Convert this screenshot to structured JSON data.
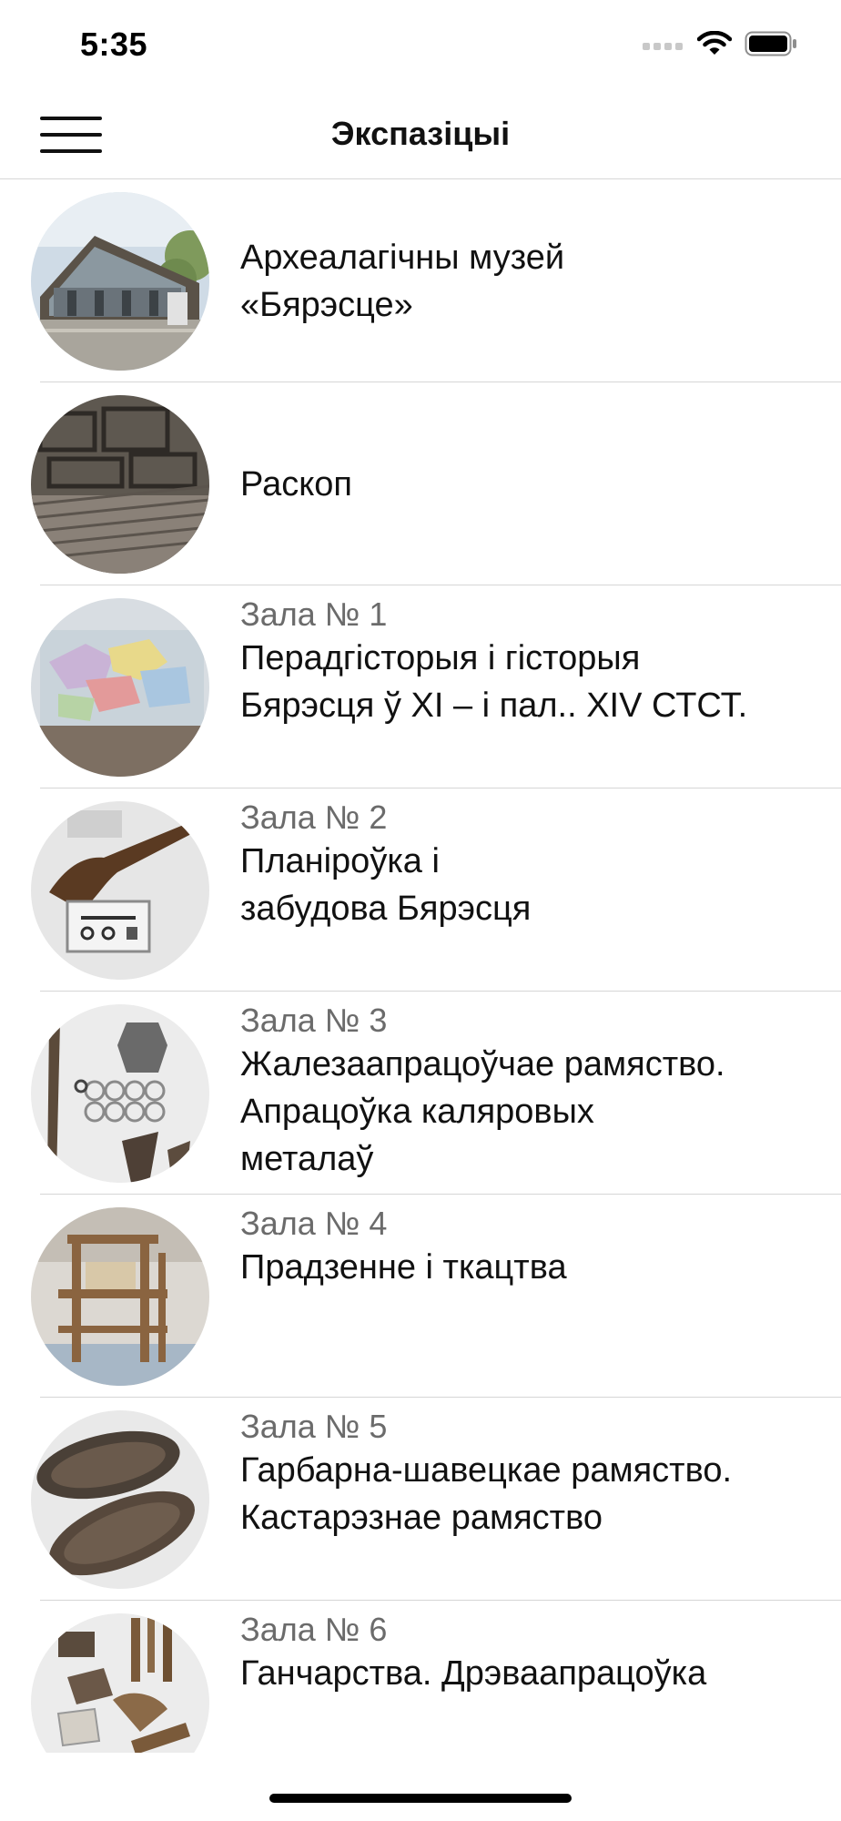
{
  "status_bar": {
    "time": "5:35"
  },
  "nav": {
    "title": "Экспазіцыі"
  },
  "items": [
    {
      "hall": "",
      "title_lines": [
        "Археалагічны музей",
        "«Бярэсце»"
      ]
    },
    {
      "hall": "",
      "title_lines": [
        "Раскоп"
      ]
    },
    {
      "hall": "Зала № 1",
      "title_lines": [
        "Перадгісторыя і гісторыя",
        "Бярэсця ў XI – і пал.. XIV СТСТ."
      ]
    },
    {
      "hall": "Зала № 2",
      "title_lines": [
        "Планіроўка і",
        "забудова Бярэсця"
      ]
    },
    {
      "hall": "Зала № 3",
      "title_lines": [
        "Жалезаапрацоўчае рамяство.",
        "Апрацоўка каляровых",
        "металаў"
      ]
    },
    {
      "hall": "Зала № 4",
      "title_lines": [
        "Прадзенне і ткацтва"
      ]
    },
    {
      "hall": "Зала № 5",
      "title_lines": [
        "Гарбарна-шавецкае рамяство.",
        "Кастарэзнае рамяство"
      ]
    },
    {
      "hall": "Зала № 6",
      "title_lines": [
        "Ганчарства. Дрэваапрацоўка"
      ]
    }
  ]
}
